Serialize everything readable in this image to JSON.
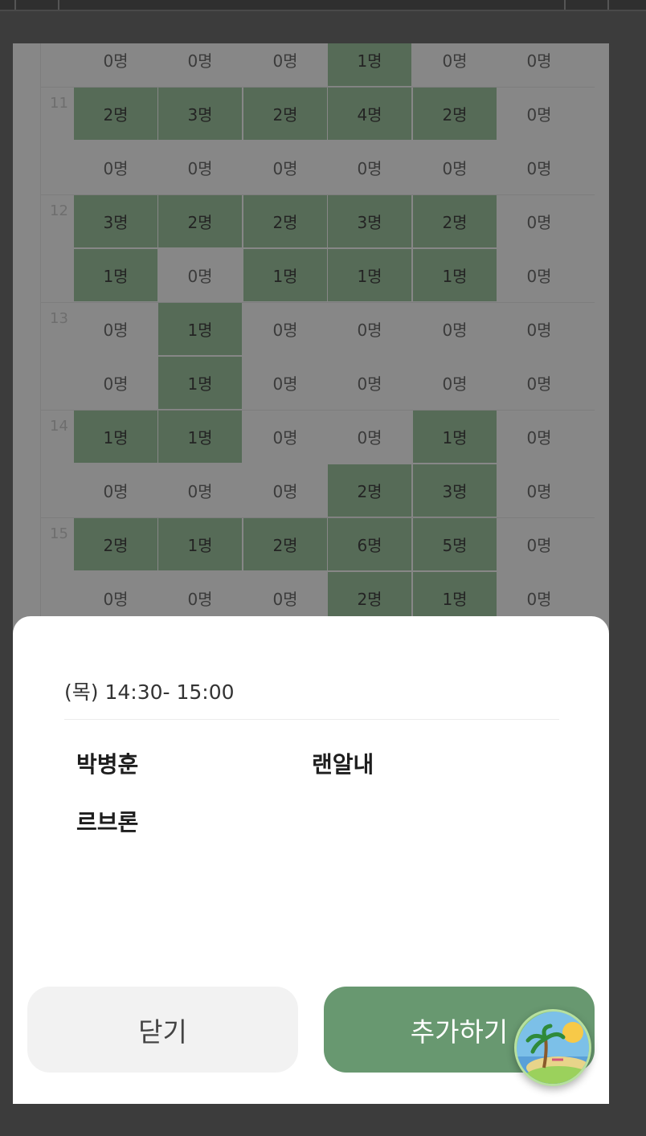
{
  "grid": {
    "rows": [
      {
        "hour": "",
        "cells": [
          [
            "0명",
            false
          ],
          [
            "0명",
            false
          ],
          [
            "0명",
            false
          ],
          [
            "1명",
            true
          ],
          [
            "0명",
            false
          ],
          [
            "0명",
            false
          ]
        ]
      },
      {
        "hour": "11",
        "cells": [
          [
            "2명",
            true
          ],
          [
            "3명",
            true
          ],
          [
            "2명",
            true
          ],
          [
            "4명",
            true
          ],
          [
            "2명",
            true
          ],
          [
            "0명",
            false
          ]
        ]
      },
      {
        "hour": "",
        "cells": [
          [
            "0명",
            false
          ],
          [
            "0명",
            false
          ],
          [
            "0명",
            false
          ],
          [
            "0명",
            false
          ],
          [
            "0명",
            false
          ],
          [
            "0명",
            false
          ]
        ]
      },
      {
        "hour": "12",
        "cells": [
          [
            "3명",
            true
          ],
          [
            "2명",
            true
          ],
          [
            "2명",
            true
          ],
          [
            "3명",
            true
          ],
          [
            "2명",
            true
          ],
          [
            "0명",
            false
          ]
        ]
      },
      {
        "hour": "",
        "cells": [
          [
            "1명",
            true
          ],
          [
            "0명",
            false
          ],
          [
            "1명",
            true
          ],
          [
            "1명",
            true
          ],
          [
            "1명",
            true
          ],
          [
            "0명",
            false
          ]
        ]
      },
      {
        "hour": "13",
        "cells": [
          [
            "0명",
            false
          ],
          [
            "1명",
            true
          ],
          [
            "0명",
            false
          ],
          [
            "0명",
            false
          ],
          [
            "0명",
            false
          ],
          [
            "0명",
            false
          ]
        ]
      },
      {
        "hour": "",
        "cells": [
          [
            "0명",
            false
          ],
          [
            "1명",
            true
          ],
          [
            "0명",
            false
          ],
          [
            "0명",
            false
          ],
          [
            "0명",
            false
          ],
          [
            "0명",
            false
          ]
        ]
      },
      {
        "hour": "14",
        "cells": [
          [
            "1명",
            true
          ],
          [
            "1명",
            true
          ],
          [
            "0명",
            false
          ],
          [
            "0명",
            false
          ],
          [
            "1명",
            true
          ],
          [
            "0명",
            false
          ]
        ]
      },
      {
        "hour": "",
        "cells": [
          [
            "0명",
            false
          ],
          [
            "0명",
            false
          ],
          [
            "0명",
            false
          ],
          [
            "2명",
            true
          ],
          [
            "3명",
            true
          ],
          [
            "0명",
            false
          ]
        ]
      },
      {
        "hour": "15",
        "cells": [
          [
            "2명",
            true
          ],
          [
            "1명",
            true
          ],
          [
            "2명",
            true
          ],
          [
            "6명",
            true
          ],
          [
            "5명",
            true
          ],
          [
            "0명",
            false
          ]
        ]
      },
      {
        "hour": "",
        "cells": [
          [
            "0명",
            false
          ],
          [
            "0명",
            false
          ],
          [
            "0명",
            false
          ],
          [
            "2명",
            true
          ],
          [
            "1명",
            true
          ],
          [
            "0명",
            false
          ]
        ]
      }
    ]
  },
  "sheet": {
    "time_range": "(목) 14:30- 15:00",
    "names": [
      "박병훈",
      "랜알내",
      "르브론"
    ],
    "close_label": "닫기",
    "add_label": "추가하기"
  },
  "colors": {
    "active_cell": "#95b996",
    "add_button": "#689870"
  },
  "icons": {
    "floating_badge": "island-icon"
  }
}
